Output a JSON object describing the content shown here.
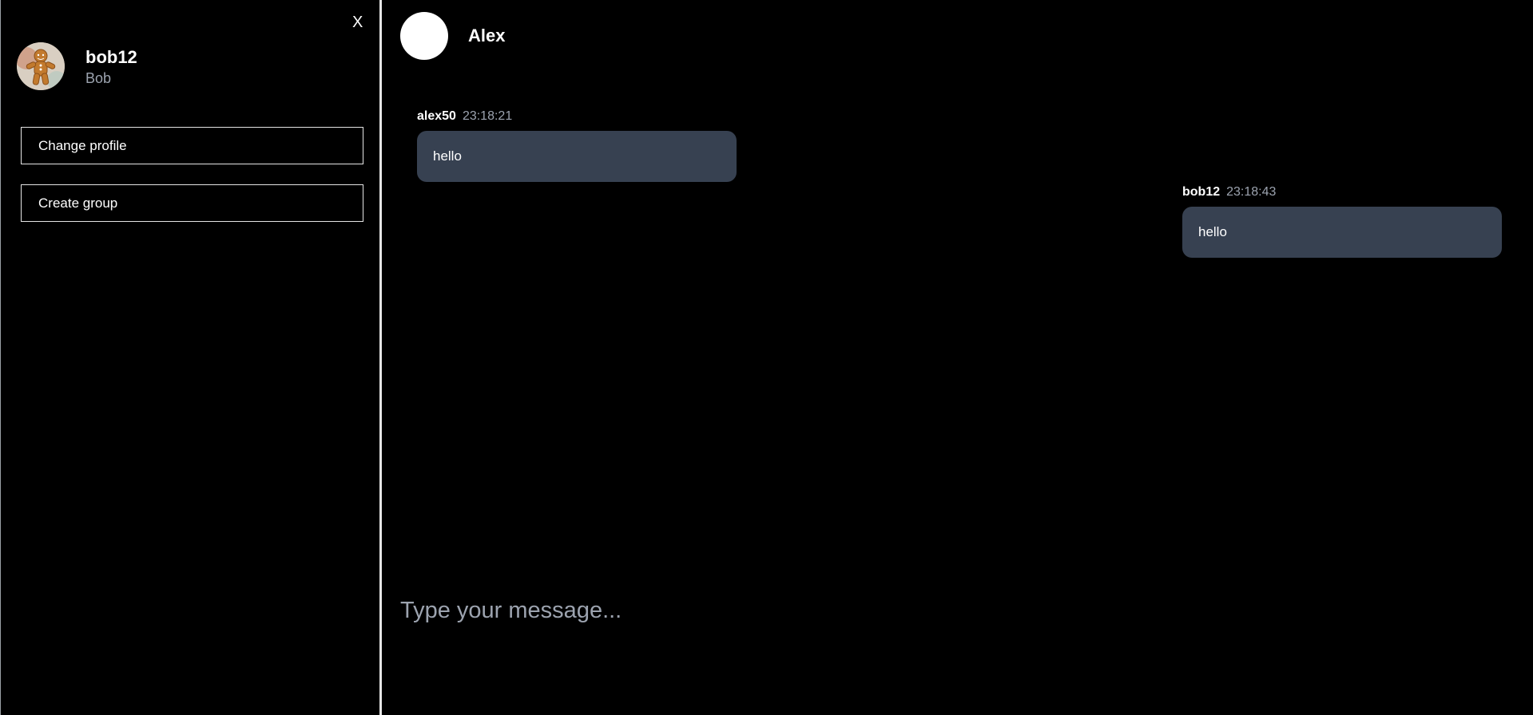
{
  "sidebar": {
    "close_label": "X",
    "user": {
      "username": "bob12",
      "display_name": "Bob",
      "avatar_icon": "gingerbread-avatar"
    },
    "buttons": {
      "change_profile": "Change profile",
      "create_group": "Create group"
    }
  },
  "chat": {
    "contact_name": "Alex",
    "messages": [
      {
        "author": "alex50",
        "time": "23:18:21",
        "text": "hello",
        "side": "left"
      },
      {
        "author": "bob12",
        "time": "23:18:43",
        "text": "hello",
        "side": "right"
      }
    ],
    "input": {
      "placeholder": "Type your message...",
      "value": ""
    }
  },
  "colors": {
    "background": "#000000",
    "bubble": "#374151",
    "muted_text": "#9ca3af",
    "border": "#e5e5e5"
  }
}
